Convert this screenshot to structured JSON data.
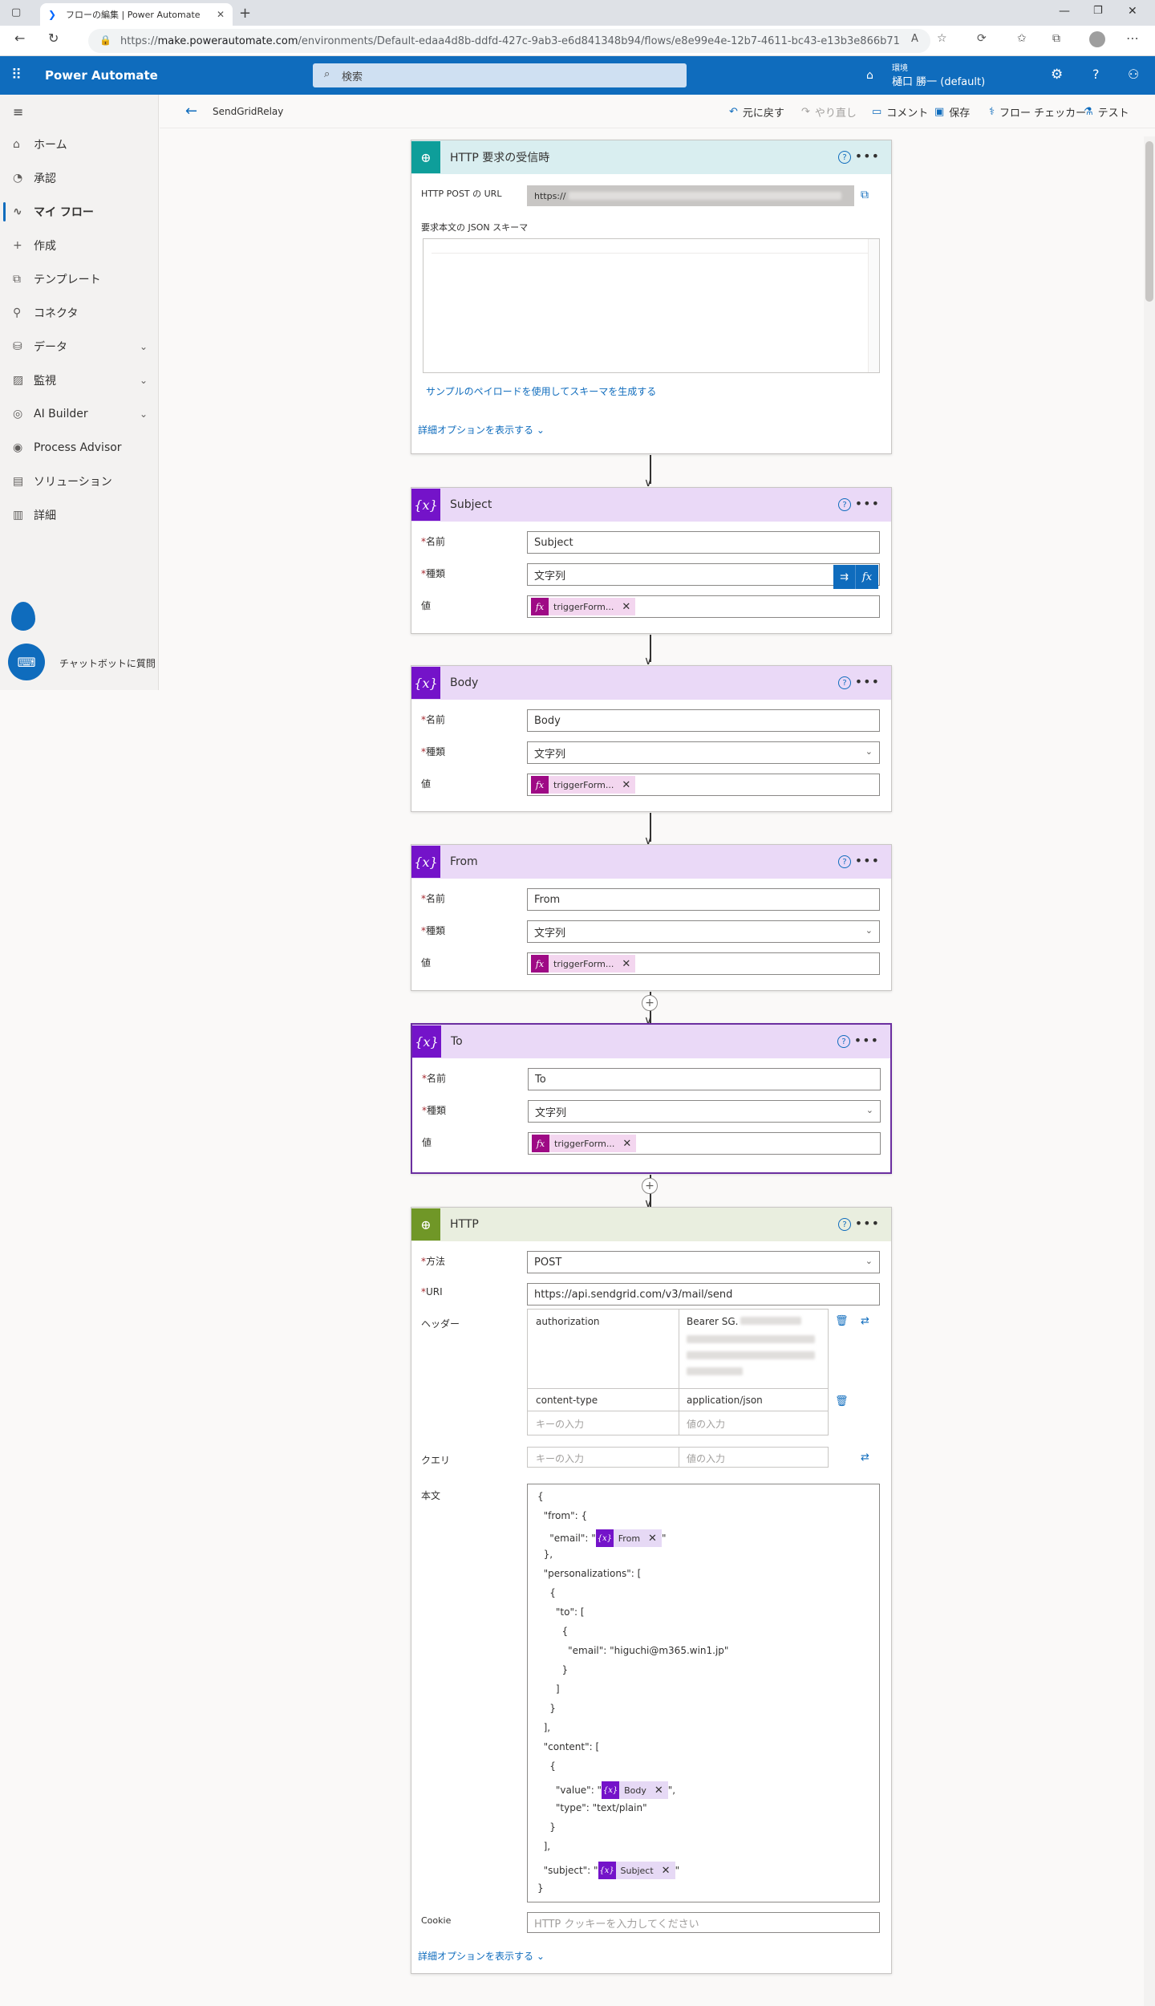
{
  "browser": {
    "tab_title": "フローの編集 | Power Automate",
    "url_prefix": "https://",
    "url_host": "make.powerautomate.com",
    "url_path": "/environments/Default-edaa4d8b-ddfd-427c-9ab3-e6d841348b94/flows/e8e99e4e-12b7-4611-bc43-e13b3e866b71"
  },
  "header": {
    "app_name": "Power Automate",
    "search_placeholder": "検索",
    "env_label": "環境",
    "env_name": "樋口 勝一 (default)"
  },
  "sidebar": {
    "items": [
      {
        "label": "ホーム",
        "icon": "home-icon"
      },
      {
        "label": "承認",
        "icon": "approval-icon"
      },
      {
        "label": "マイ フロー",
        "icon": "flow-icon"
      },
      {
        "label": "作成",
        "icon": "plus-icon"
      },
      {
        "label": "テンプレート",
        "icon": "template-icon"
      },
      {
        "label": "コネクタ",
        "icon": "connector-icon"
      },
      {
        "label": "データ",
        "icon": "data-icon"
      },
      {
        "label": "監視",
        "icon": "monitor-icon"
      },
      {
        "label": "AI Builder",
        "icon": "ai-builder-icon"
      },
      {
        "label": "Process Advisor",
        "icon": "process-advisor-icon"
      },
      {
        "label": "ソリューション",
        "icon": "solution-icon"
      },
      {
        "label": "詳細",
        "icon": "book-icon"
      }
    ],
    "chatbot_label": "チャットボットに質問"
  },
  "cmdbar": {
    "flow_name": "SendGridRelay",
    "undo": "元に戻す",
    "redo": "やり直し",
    "comment": "コメント",
    "save": "保存",
    "checker": "フロー チェッカー",
    "test": "テスト"
  },
  "trigger": {
    "title": "HTTP 要求の受信時",
    "url_label": "HTTP POST の URL",
    "url_value": "https://",
    "schema_label": "要求本文の JSON スキーマ",
    "schema_link": "サンプルのペイロードを使用してスキーマを生成する",
    "advanced": "詳細オプションを表示する"
  },
  "field_labels": {
    "name": "名前",
    "type": "種類",
    "value": "値"
  },
  "variables": [
    {
      "title": "Subject",
      "name": "Subject",
      "type": "文字列",
      "token": "triggerForm..."
    },
    {
      "title": "Body",
      "name": "Body",
      "type": "文字列",
      "token": "triggerForm..."
    },
    {
      "title": "From",
      "name": "From",
      "type": "文字列",
      "token": "triggerForm..."
    },
    {
      "title": "To",
      "name": "To",
      "type": "文字列",
      "token": "triggerForm..."
    }
  ],
  "http": {
    "title": "HTTP",
    "method_label": "方法",
    "method": "POST",
    "uri_label": "URI",
    "uri": "https://api.sendgrid.com/v3/mail/send",
    "headers_label": "ヘッダー",
    "headers": [
      {
        "key": "authorization",
        "value": "Bearer SG."
      },
      {
        "key": "content-type",
        "value": "application/json"
      }
    ],
    "key_placeholder": "キーの入力",
    "value_placeholder": "値の入力",
    "query_label": "クエリ",
    "body_label": "本文",
    "body_lines": [
      "{",
      "  \"from\": {",
      "    \"email\": \"",
      "  },",
      "  \"personalizations\": [",
      "    {",
      "      \"to\": [",
      "        {",
      "          \"email\": \"higuchi@m365.win1.jp\"",
      "        }",
      "      ]",
      "    }",
      "  ],",
      "  \"content\": [",
      "    {",
      "      \"value\": \"",
      "      \"type\": \"text/plain\"",
      "    }",
      "  ],",
      "  \"subject\": \"",
      "}"
    ],
    "body_tokens": {
      "from": "From",
      "content": "Body",
      "subject": "Subject"
    },
    "body_token_suffix_close": "\"",
    "body_token_suffix_comma": "\",",
    "cookie_label": "Cookie",
    "cookie_placeholder": "HTTP クッキーを入力してください",
    "advanced": "詳細オプションを表示する"
  },
  "colors": {
    "brand": "#0f6cbd",
    "trigger_badge": "#0e9e9a",
    "trigger_header": "#d9eef0",
    "variable_badge": "#7413c9",
    "variable_header": "#ead9f7",
    "http_badge": "#709727",
    "http_header": "#e9eedf"
  }
}
